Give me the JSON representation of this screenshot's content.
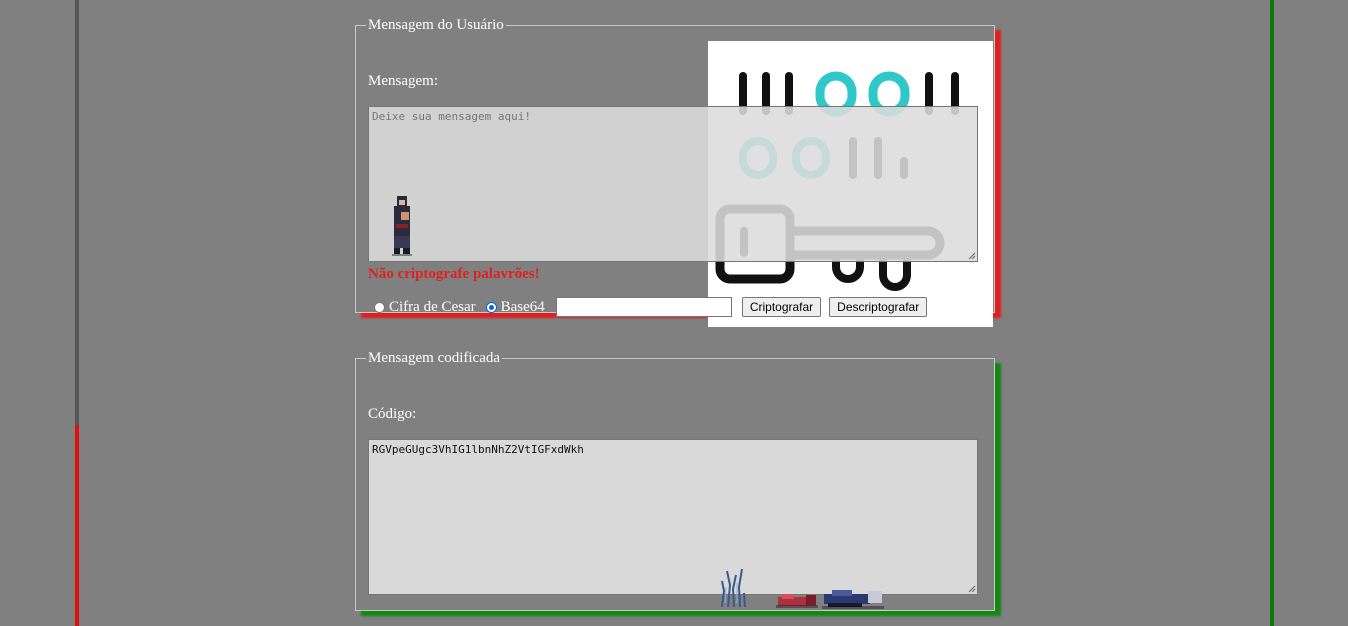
{
  "user_form": {
    "legend": "Mensagem do Usuário",
    "message_label": "Mensagem:",
    "message_placeholder": "Deixe sua mensagem aqui!",
    "warning": "Não criptografe palavrões!",
    "options": {
      "caesar_label": "Cifra de Cesar",
      "base64_label": "Base64",
      "selected": "Base64"
    },
    "shift_value": "",
    "encrypt_button": "Criptografar",
    "decrypt_button": "Descriptografar"
  },
  "coded_form": {
    "legend": "Mensagem codificada",
    "code_label": "Código:",
    "code_value": "RGVpeGUgc3VhIG1lbnNhZ2VtIGFxdWkh"
  },
  "colors": {
    "background": "#808080",
    "user_form_shadow": "#e02020",
    "coded_form_shadow": "#128a12",
    "warning": "#e02020",
    "left_bar_top": "#555555",
    "left_bar_bottom": "#e01010",
    "right_bar": "#0a7a0a",
    "binary_teal": "#2ec8c8"
  },
  "icons": [
    "binary-key-illustration",
    "pixel-character-sprite",
    "pixel-flame-sprite",
    "pixel-fallen-characters-sprite",
    "resize-grip-icon"
  ]
}
